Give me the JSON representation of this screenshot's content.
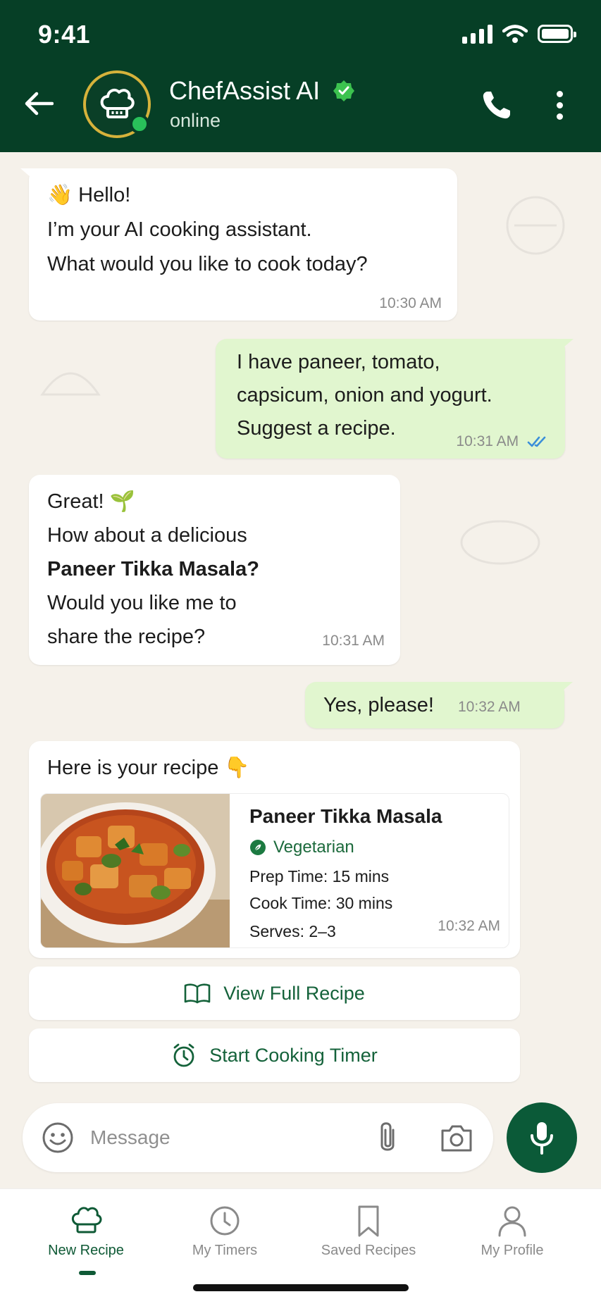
{
  "status_bar": {
    "time": "9:41"
  },
  "header": {
    "title": "ChefAssist AI",
    "status": "online"
  },
  "messages": {
    "m1": {
      "lines": [
        "👋 Hello!",
        "I’m your AI cooking assistant.",
        "What would you like to cook today?"
      ],
      "time": "10:30 AM"
    },
    "m2": {
      "lines": [
        "I have paneer, tomato,",
        "capsicum, onion and yogurt.",
        "Suggest a recipe."
      ],
      "time": "10:31 AM"
    },
    "m3": {
      "line1": "Great! 🌱",
      "line2": "How about a delicious",
      "line3_bold": "Paneer Tikka Masala?",
      "line4": "Would you like me to",
      "line5": "share the recipe?",
      "time": "10:31 AM"
    },
    "m4": {
      "text": "Yes, please!",
      "time": "10:32 AM"
    },
    "m5": {
      "intro": "Here is your recipe 👇",
      "recipe": {
        "title": "Paneer Tikka Masala",
        "tag": "Vegetarian",
        "prep": "Prep Time: 15 mins",
        "cook": "Cook Time: 30 mins",
        "serves": "Serves: 2–3"
      },
      "time": "10:32 AM"
    }
  },
  "actions": {
    "view_recipe": "View Full Recipe",
    "start_timer": "Start Cooking Timer"
  },
  "composer": {
    "placeholder": "Message"
  },
  "bottom_nav": {
    "items": [
      {
        "label": "New Recipe",
        "icon": "chef-hat-icon",
        "active": true
      },
      {
        "label": "My Timers",
        "icon": "clock-icon",
        "active": false
      },
      {
        "label": "Saved Recipes",
        "icon": "bookmark-icon",
        "active": false
      },
      {
        "label": "My Profile",
        "icon": "person-icon",
        "active": false
      }
    ]
  },
  "colors": {
    "header_bg": "#063f26",
    "chat_bg": "#f5f1ea",
    "outgoing_bubble": "#e1f6cf",
    "accent_green": "#0b5a38",
    "read_ticks": "#3b8fd9"
  }
}
